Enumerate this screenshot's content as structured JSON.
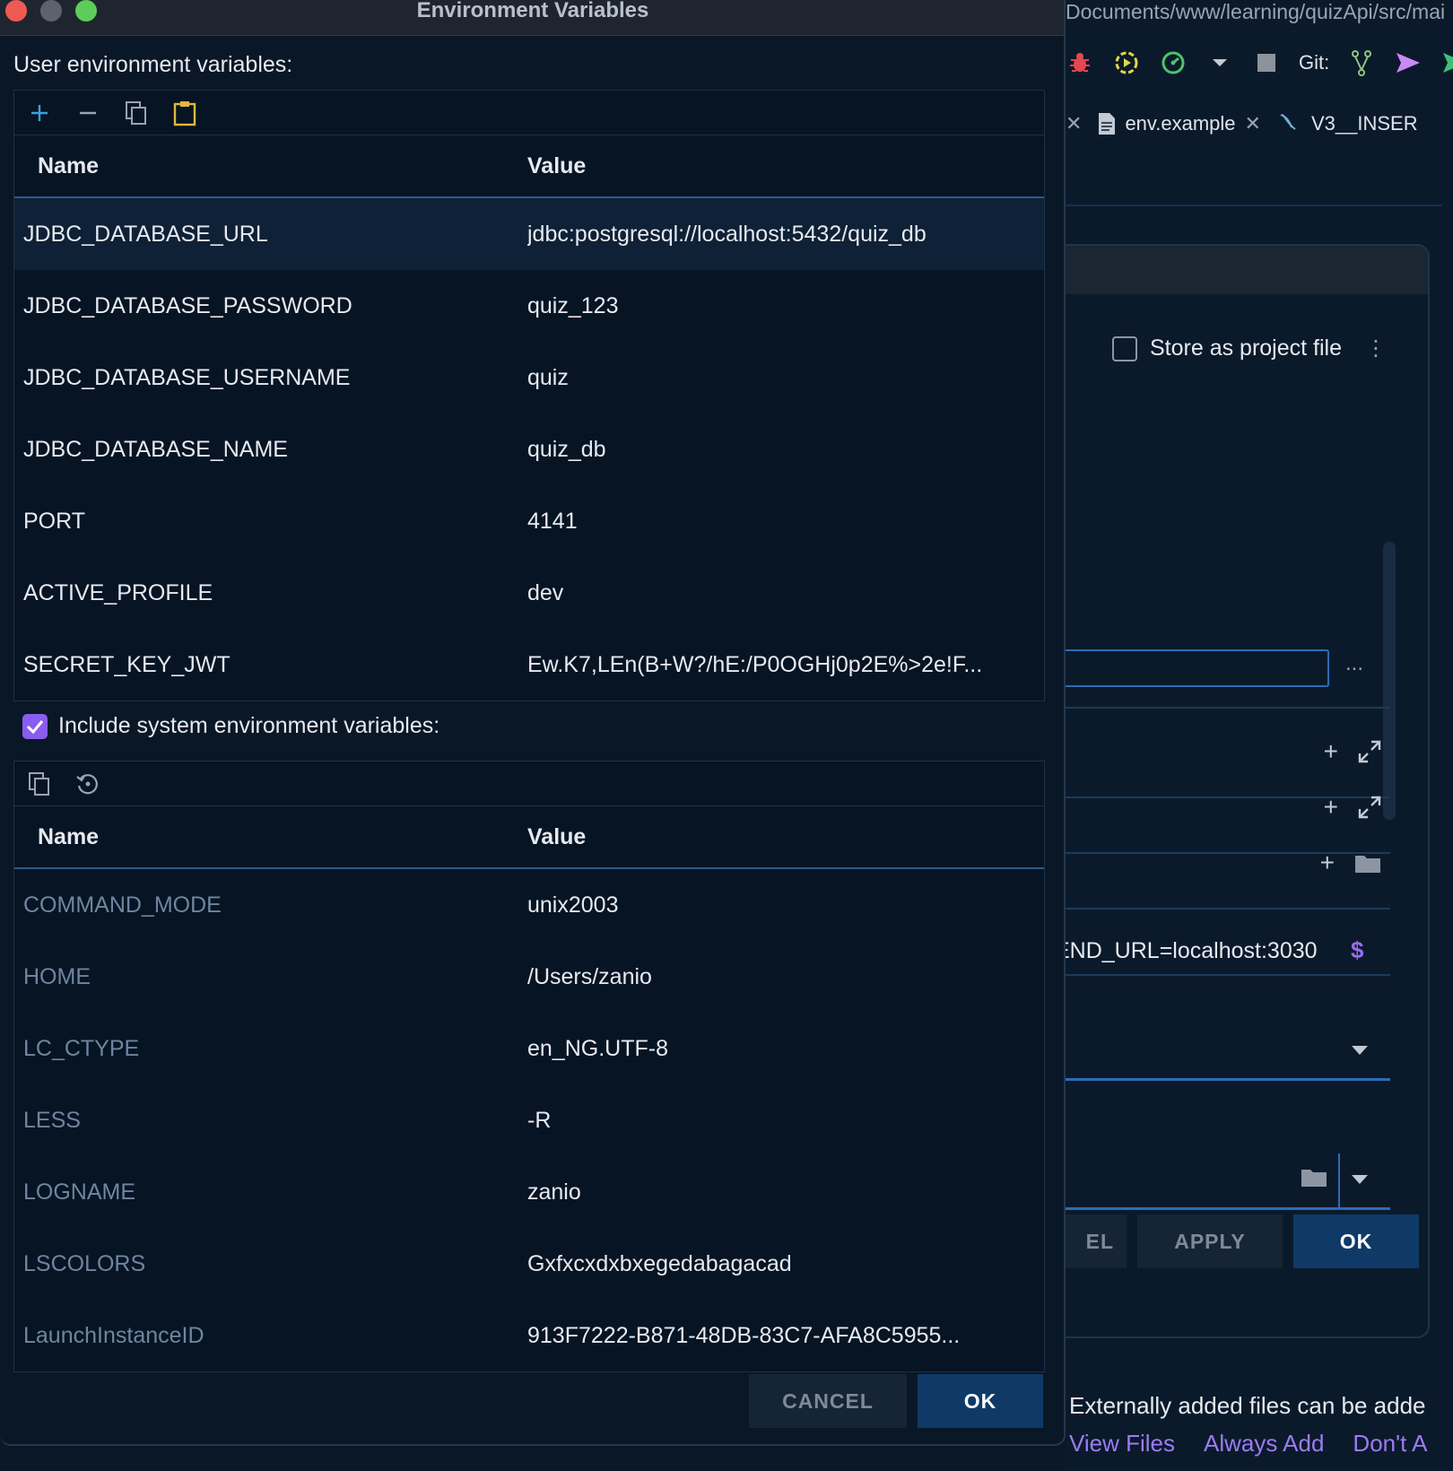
{
  "dialog": {
    "title": "Environment Variables",
    "user_section_label": "User environment variables:",
    "include_system_label": "Include system environment variables:",
    "include_system_checked": true,
    "cancel_label": "CANCEL",
    "ok_label": "OK"
  },
  "user_table": {
    "headers": {
      "name": "Name",
      "value": "Value"
    },
    "rows": [
      {
        "name": "JDBC_DATABASE_URL",
        "value": "jdbc:postgresql://localhost:5432/quiz_db"
      },
      {
        "name": "JDBC_DATABASE_PASSWORD",
        "value": "quiz_123"
      },
      {
        "name": "JDBC_DATABASE_USERNAME",
        "value": "quiz"
      },
      {
        "name": "JDBC_DATABASE_NAME",
        "value": "quiz_db"
      },
      {
        "name": "PORT",
        "value": "4141"
      },
      {
        "name": "ACTIVE_PROFILE",
        "value": "dev"
      },
      {
        "name": "SECRET_KEY_JWT",
        "value": "Ew.K7,LEn(B+W?/hE:/P0OGHj0p2E%>2e!F..."
      }
    ]
  },
  "system_table": {
    "headers": {
      "name": "Name",
      "value": "Value"
    },
    "rows": [
      {
        "name": "COMMAND_MODE",
        "value": "unix2003"
      },
      {
        "name": "HOME",
        "value": "/Users/zanio"
      },
      {
        "name": "LC_CTYPE",
        "value": "en_NG.UTF-8"
      },
      {
        "name": "LESS",
        "value": "-R"
      },
      {
        "name": "LOGNAME",
        "value": "zanio"
      },
      {
        "name": "LSCOLORS",
        "value": "Gxfxcxdxbxegedabagacad"
      },
      {
        "name": "LaunchInstanceID",
        "value": "913F7222-B871-48DB-83C7-AFA8C5955..."
      }
    ]
  },
  "background_ide": {
    "path": "Documents/www/learning/quizApi/src/mai",
    "git_label": "Git:",
    "tabs": [
      {
        "label": "env.example"
      },
      {
        "label": "V3__INSER"
      }
    ],
    "run_dialog": {
      "store_as_project_file": "Store as project file",
      "env_value": "END_URL=localhost:3030",
      "dollar": "$",
      "dots": "...",
      "buttons": {
        "cancel_partial": "EL",
        "apply": "APPLY",
        "ok": "OK"
      }
    },
    "notice": "Externally added files can be adde",
    "links": [
      "View Files",
      "Always Add",
      "Don't A"
    ]
  },
  "colors": {
    "accent_purple": "#8a5cf0",
    "ok_button": "#0f3a68",
    "selection_line": "#2a5a8c",
    "traffic_red": "#ee5b52",
    "traffic_green": "#5ccd5a"
  }
}
